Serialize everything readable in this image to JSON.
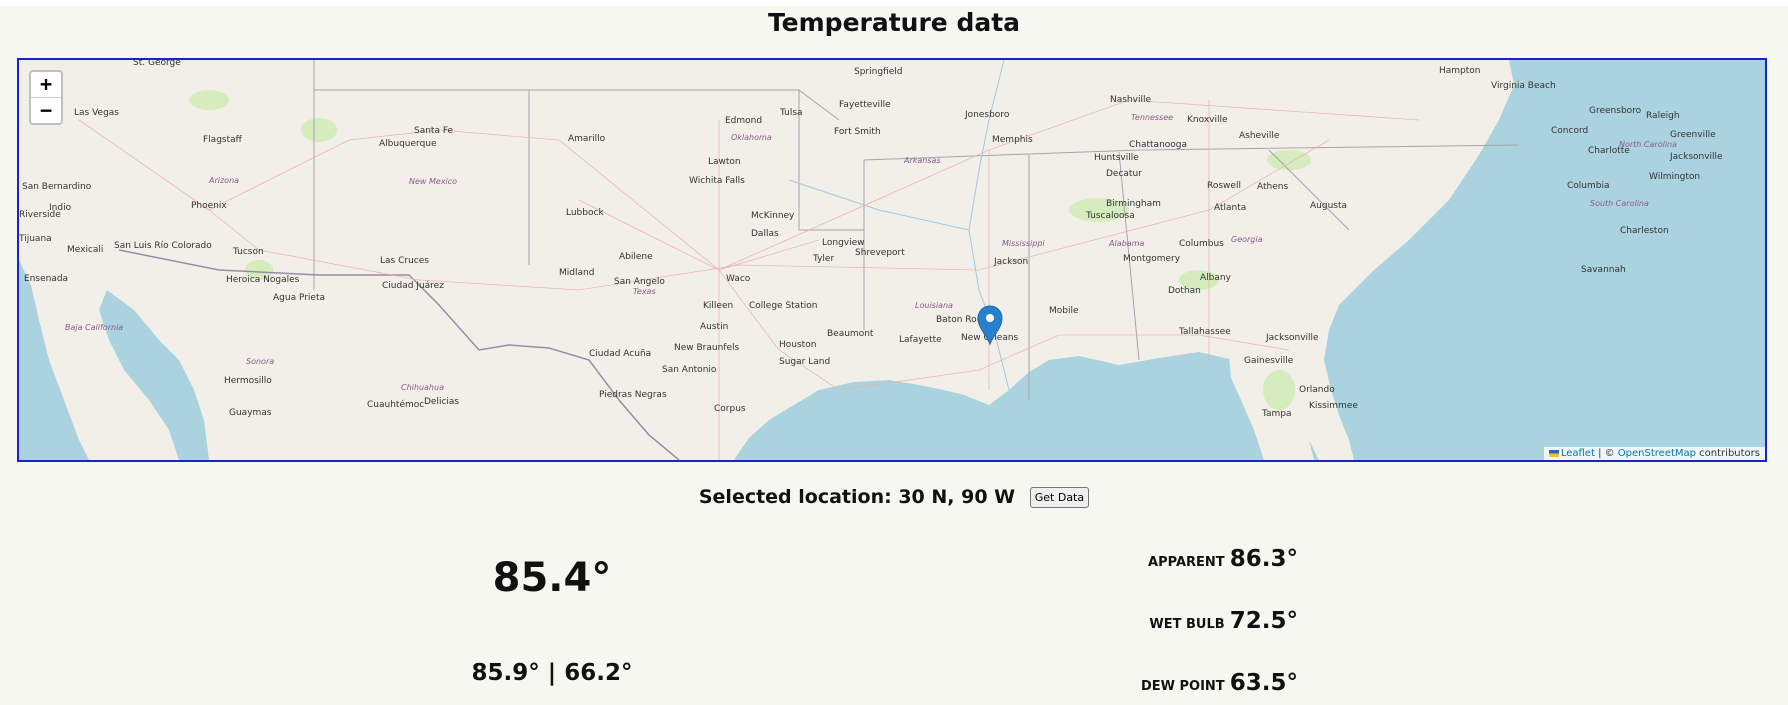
{
  "page": {
    "title": "Temperature data"
  },
  "map": {
    "zoom_in": "+",
    "zoom_out": "−",
    "marker_icon": "map-pin-icon",
    "attribution": {
      "leaflet": "Leaflet",
      "separator": " | © ",
      "osm": "OpenStreetMap",
      "suffix": " contributors"
    },
    "cities": [
      {
        "name": "St. George"
      },
      {
        "name": "Springfield"
      },
      {
        "name": "Hampton"
      },
      {
        "name": "Virginia Beach"
      },
      {
        "name": "Las Vegas"
      },
      {
        "name": "Santa Fe"
      },
      {
        "name": "Tulsa"
      },
      {
        "name": "Fayetteville"
      },
      {
        "name": "Nashville"
      },
      {
        "name": "Greensboro"
      },
      {
        "name": "Raleigh"
      },
      {
        "name": "Edmond"
      },
      {
        "name": "Jonesboro"
      },
      {
        "name": "Knoxville"
      },
      {
        "name": "Flagstaff"
      },
      {
        "name": "Albuquerque"
      },
      {
        "name": "Amarillo"
      },
      {
        "name": "Fort Smith"
      },
      {
        "name": "Memphis"
      },
      {
        "name": "Asheville"
      },
      {
        "name": "Concord"
      },
      {
        "name": "Greenville"
      },
      {
        "name": "Chattanooga"
      },
      {
        "name": "Charlotte"
      },
      {
        "name": "Lawton"
      },
      {
        "name": "Huntsville"
      },
      {
        "name": "Jacksonville"
      },
      {
        "name": "San Bernardino"
      },
      {
        "name": "Wichita Falls"
      },
      {
        "name": "Decatur"
      },
      {
        "name": "Roswell"
      },
      {
        "name": "Athens"
      },
      {
        "name": "Columbia"
      },
      {
        "name": "Wilmington"
      },
      {
        "name": "Indio"
      },
      {
        "name": "Phoenix"
      },
      {
        "name": "Lubbock"
      },
      {
        "name": "McKinney"
      },
      {
        "name": "Birmingham"
      },
      {
        "name": "Atlanta"
      },
      {
        "name": "Augusta"
      },
      {
        "name": "Dallas"
      },
      {
        "name": "Tuscaloosa"
      },
      {
        "name": "Charleston"
      },
      {
        "name": "Mexicali"
      },
      {
        "name": "San Luis Río Colorado"
      },
      {
        "name": "Tucson"
      },
      {
        "name": "Longview"
      },
      {
        "name": "Abilene"
      },
      {
        "name": "Tyler"
      },
      {
        "name": "Shreveport"
      },
      {
        "name": "Columbus"
      },
      {
        "name": "Las Cruces"
      },
      {
        "name": "Midland"
      },
      {
        "name": "Jackson"
      },
      {
        "name": "Montgomery"
      },
      {
        "name": "Savannah"
      },
      {
        "name": "Ensenada"
      },
      {
        "name": "Heroica Nogales"
      },
      {
        "name": "Ciudad Juárez"
      },
      {
        "name": "Waco"
      },
      {
        "name": "San Angelo"
      },
      {
        "name": "Albany"
      },
      {
        "name": "Dothan"
      },
      {
        "name": "Agua Prieta"
      },
      {
        "name": "Killeen"
      },
      {
        "name": "College Station"
      },
      {
        "name": "Mobile"
      },
      {
        "name": "Baton Rouge"
      },
      {
        "name": "Austin"
      },
      {
        "name": "Tallahassee"
      },
      {
        "name": "Beaumont"
      },
      {
        "name": "Lafayette"
      },
      {
        "name": "New Orleans"
      },
      {
        "name": "Jacksonville"
      },
      {
        "name": "Houston"
      },
      {
        "name": "New Braunfels"
      },
      {
        "name": "Ciudad Acuña"
      },
      {
        "name": "Gainesville"
      },
      {
        "name": "San Antonio"
      },
      {
        "name": "Sugar Land"
      },
      {
        "name": "Hermosillo"
      },
      {
        "name": "Orlando"
      },
      {
        "name": "Piedras Negras"
      },
      {
        "name": "Cuauhtémoc"
      },
      {
        "name": "Delicias"
      },
      {
        "name": "Kissimmee"
      },
      {
        "name": "Corpus"
      },
      {
        "name": "Tampa"
      },
      {
        "name": "Guaymas"
      },
      {
        "name": "Tijuana"
      },
      {
        "name": "Riverside"
      }
    ],
    "states": [
      {
        "name": "Arizona"
      },
      {
        "name": "New Mexico"
      },
      {
        "name": "Oklahoma"
      },
      {
        "name": "Arkansas"
      },
      {
        "name": "Tennessee"
      },
      {
        "name": "North Carolina"
      },
      {
        "name": "South Carolina"
      },
      {
        "name": "Mississippi"
      },
      {
        "name": "Alabama"
      },
      {
        "name": "Georgia"
      },
      {
        "name": "Texas"
      },
      {
        "name": "Louisiana"
      },
      {
        "name": "Baja California"
      },
      {
        "name": "Sonora"
      },
      {
        "name": "Chihuahua"
      }
    ]
  },
  "location": {
    "text": "Selected location: 30 N, 90 W",
    "button": "Get Data"
  },
  "current": {
    "temperature": "85.4°",
    "high_low": "85.9° | 66.2°"
  },
  "metrics": [
    {
      "label": "APPARENT",
      "value": "86.3°"
    },
    {
      "label": "WET BULB",
      "value": "72.5°"
    },
    {
      "label": "DEW POINT",
      "value": "63.5°"
    }
  ]
}
